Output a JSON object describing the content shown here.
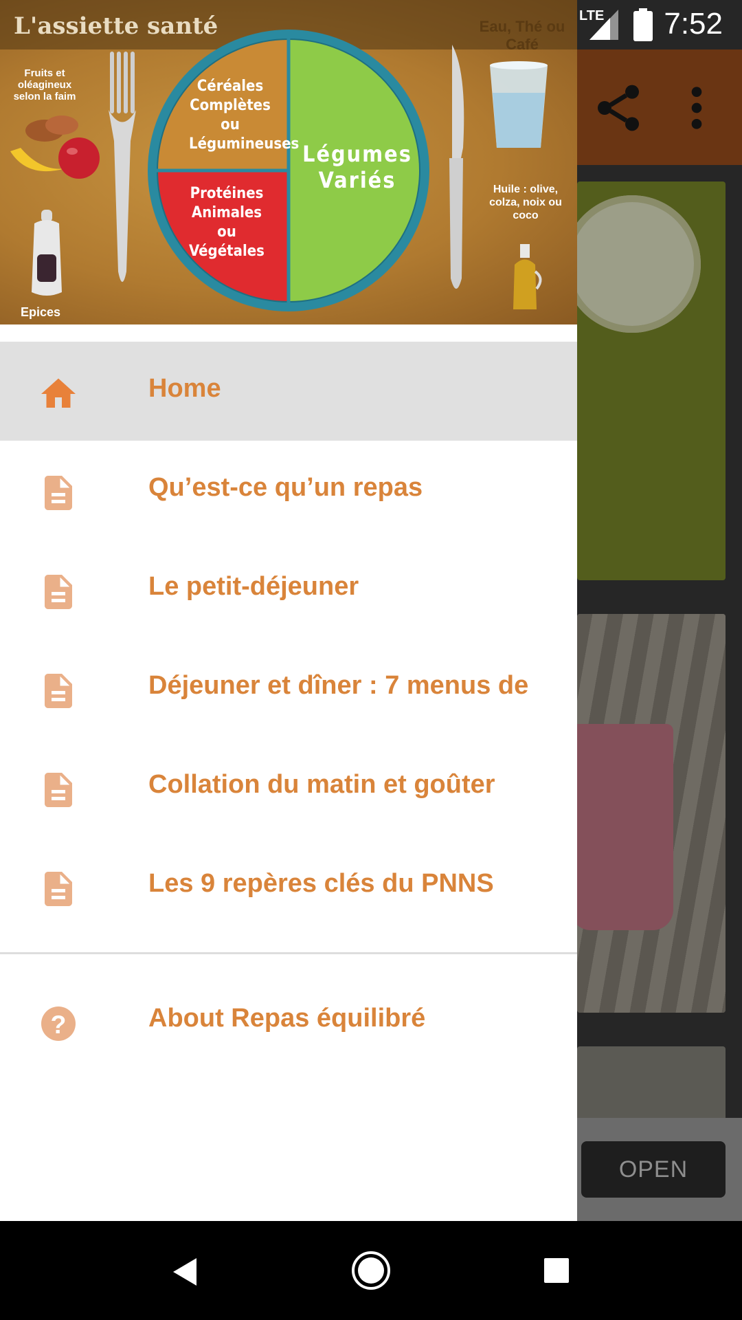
{
  "status_bar": {
    "network": "LTE",
    "time": "7:52"
  },
  "drawer_header": {
    "title": "L'assiette santé",
    "water_label": "Eau, Thé ou Café",
    "fruits_label": "Fruits et oléagineux selon la faim",
    "spices_label": "Epices",
    "oil_label": "Huile : olive, colza, noix ou coco",
    "cereals_label": "Céréales Complètes ou Légumineuses",
    "proteins_label": "Protéines Animales ou Végétales",
    "vegetables_label": "Légumes Variés"
  },
  "menu": {
    "items": [
      {
        "label": "Home",
        "icon": "home-icon",
        "active": true
      },
      {
        "label": "Qu’est-ce qu’un repas",
        "icon": "document-icon"
      },
      {
        "label": "Le petit-déjeuner",
        "icon": "document-icon"
      },
      {
        "label": "Déjeuner et dîner : 7 menus de",
        "icon": "document-icon"
      },
      {
        "label": "Collation du matin et goûter",
        "icon": "document-icon"
      },
      {
        "label": "Les 9 repères clés du PNNS",
        "icon": "document-icon"
      }
    ],
    "about": {
      "label": "About Repas équilibré",
      "icon": "help-icon"
    }
  },
  "background_app": {
    "open_button": "OPEN"
  },
  "colors": {
    "accent": "#d9843a",
    "icon_light": "#eab089",
    "toolbar": "#6a3513"
  }
}
